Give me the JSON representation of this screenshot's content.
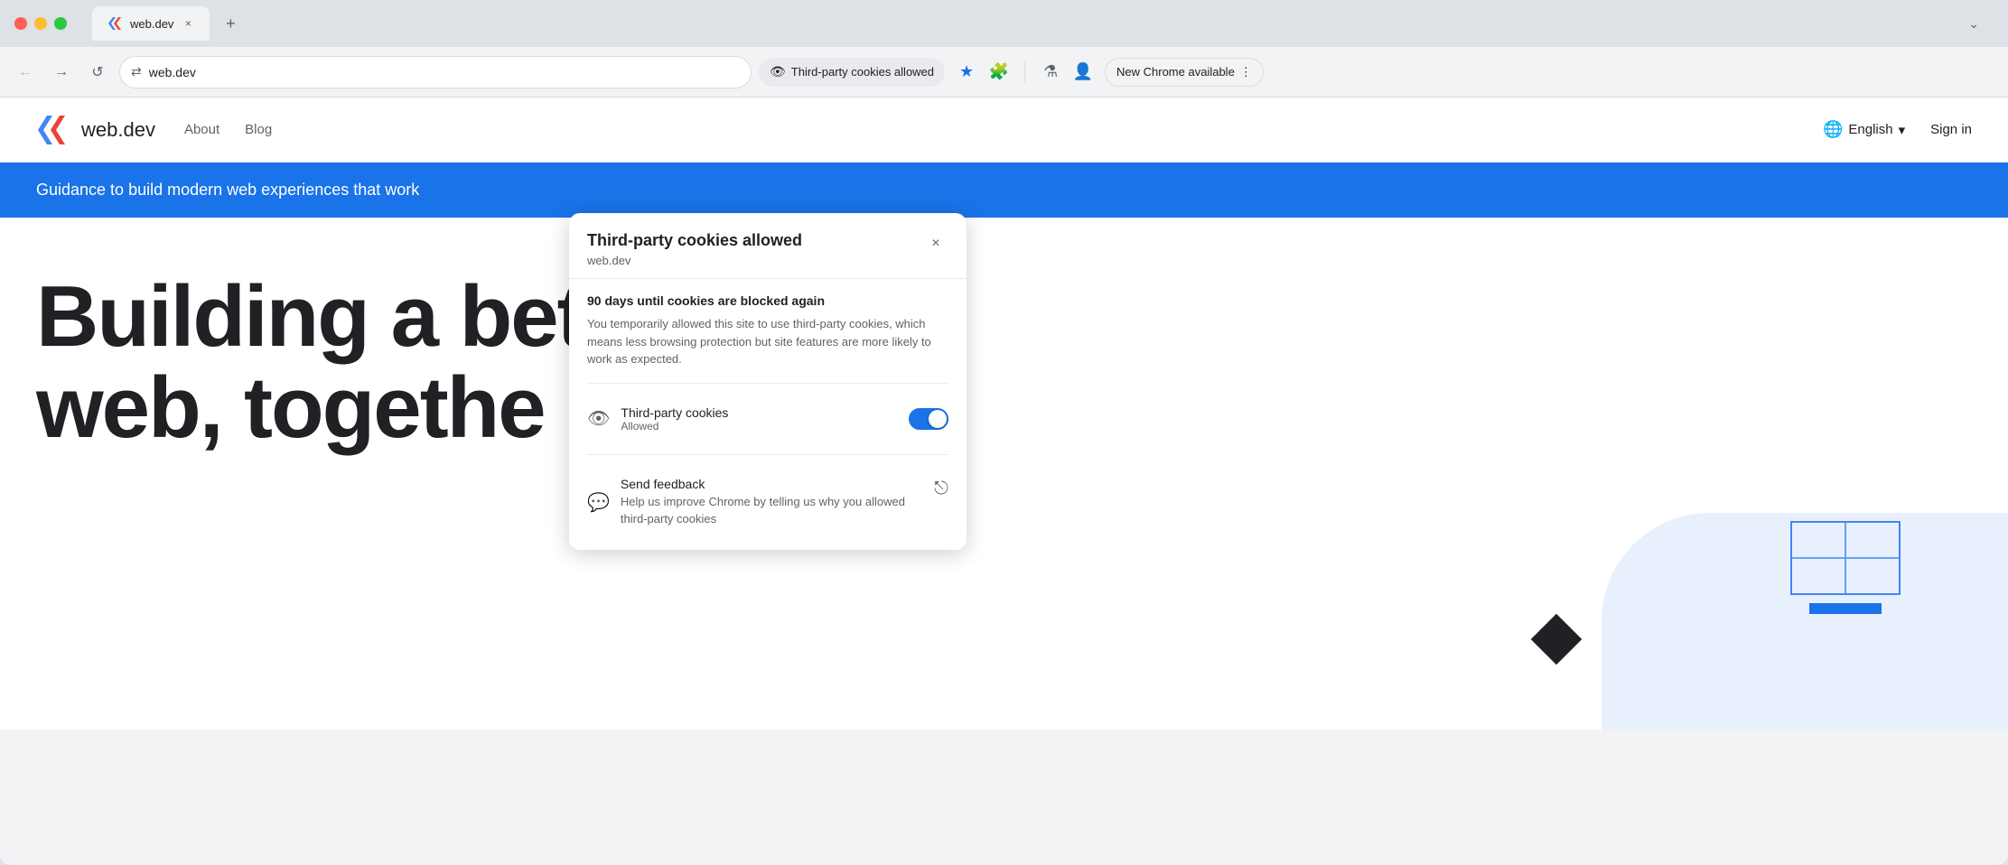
{
  "browser": {
    "tab": {
      "favicon_label": "web.dev favicon",
      "label": "web.dev",
      "close_label": "×"
    },
    "new_tab_label": "+",
    "expand_label": "⌄",
    "nav": {
      "back_label": "←",
      "forward_label": "→",
      "reload_label": "↺",
      "url_icon": "⇄",
      "url": "web.dev"
    },
    "cookies_button": {
      "icon": "👁",
      "label": "Third-party cookies allowed"
    },
    "star_label": "★",
    "extensions_label": "🧩",
    "lab_label": "⚗",
    "profile_label": "👤",
    "new_chrome": {
      "label": "New Chrome available",
      "menu_icon": "⋮"
    }
  },
  "website": {
    "logo_text": "web.dev",
    "nav_links": [
      "About",
      "Blog"
    ],
    "lang_button": "English",
    "signin_label": "Sign in",
    "hero_banner": "Guidance to build modern web experiences that work",
    "hero_title_line1": "Building a bet",
    "hero_title_line2": "web, togethe"
  },
  "popup": {
    "title": "Third-party cookies allowed",
    "subtitle": "web.dev",
    "close_label": "×",
    "warning_title": "90 days until cookies are blocked again",
    "warning_text": "You temporarily allowed this site to use third-party cookies, which means less browsing protection but site features are more likely to work as expected.",
    "cookies_row": {
      "icon": "👁",
      "title": "Third-party cookies",
      "subtitle": "Allowed"
    },
    "feedback_row": {
      "icon": "💬",
      "title": "Send feedback",
      "text": "Help us improve Chrome by telling us why you allowed third-party cookies",
      "external_icon": "⬡"
    }
  }
}
